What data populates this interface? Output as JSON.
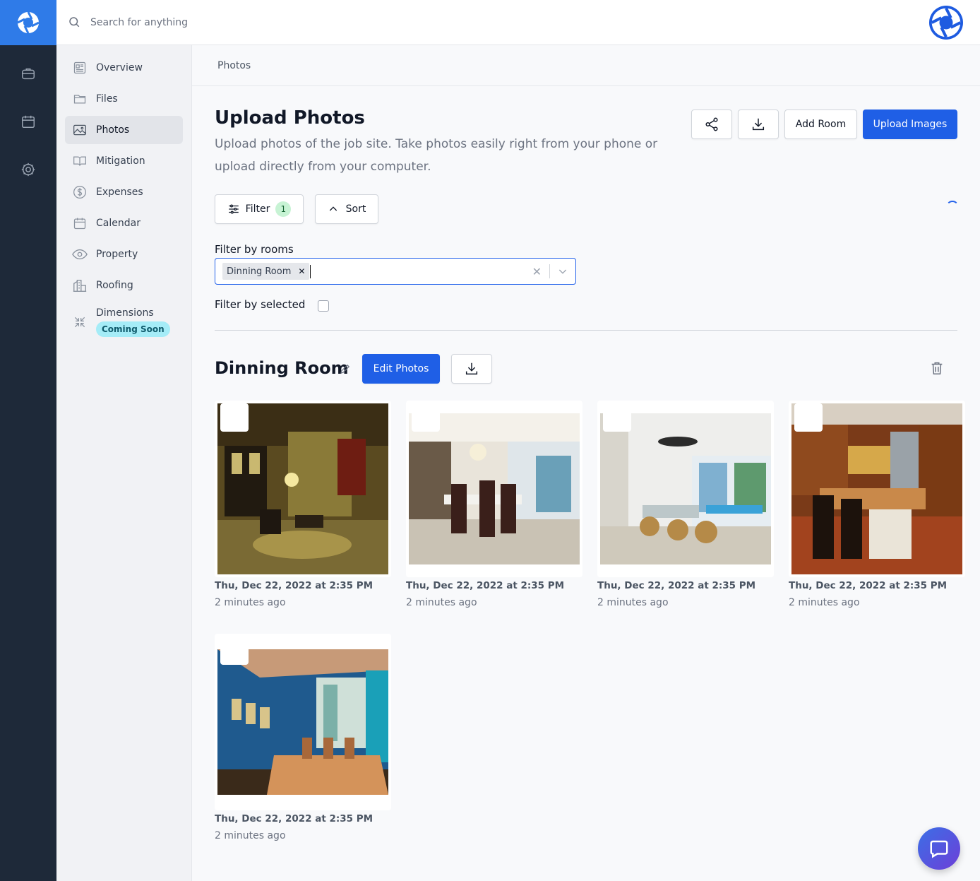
{
  "search": {
    "placeholder": "Search for anything"
  },
  "nav": {
    "items": [
      {
        "label": "Overview",
        "icon": "overview-icon"
      },
      {
        "label": "Files",
        "icon": "folder-icon"
      },
      {
        "label": "Photos",
        "icon": "image-icon",
        "active": true
      },
      {
        "label": "Mitigation",
        "icon": "book-icon"
      },
      {
        "label": "Expenses",
        "icon": "dollar-icon"
      },
      {
        "label": "Calendar",
        "icon": "calendar-icon"
      },
      {
        "label": "Property",
        "icon": "eye-icon"
      },
      {
        "label": "Roofing",
        "icon": "building-icon"
      },
      {
        "label": "Dimensions",
        "icon": "collapse-icon",
        "badge": "Coming Soon"
      }
    ]
  },
  "breadcrumb": "Photos",
  "header": {
    "title": "Upload Photos",
    "description": "Upload photos of the job site. Take photos easily right from your phone or upload directly from your computer.",
    "add_room_label": "Add Room",
    "upload_label": "Upload Images"
  },
  "toolbar": {
    "filter_label": "Filter",
    "filter_count": "1",
    "sort_label": "Sort"
  },
  "filters": {
    "rooms_label": "Filter by rooms",
    "selected_room": "Dinning Room",
    "selected_label": "Filter by selected"
  },
  "room": {
    "title": "Dinning Room",
    "edit_label": "Edit Photos",
    "photos": [
      {
        "date": "Thu, Dec 22, 2022 at 2:35 PM",
        "ago": "2 minutes ago",
        "scene": "lobby"
      },
      {
        "date": "Thu, Dec 22, 2022 at 2:35 PM",
        "ago": "2 minutes ago",
        "scene": "dining-white"
      },
      {
        "date": "Thu, Dec 22, 2022 at 2:35 PM",
        "ago": "2 minutes ago",
        "scene": "sunroom"
      },
      {
        "date": "Thu, Dec 22, 2022 at 2:35 PM",
        "ago": "2 minutes ago",
        "scene": "kitchen"
      },
      {
        "date": "Thu, Dec 22, 2022 at 2:35 PM",
        "ago": "2 minutes ago",
        "scene": "blue-dining"
      }
    ]
  },
  "colors": {
    "primary": "#1f5fe6",
    "rail": "#1e2939",
    "logo_bg": "#2f7be8",
    "badge_bg": "#a5ecf7",
    "filter_count_bg": "#c7f3d4"
  }
}
